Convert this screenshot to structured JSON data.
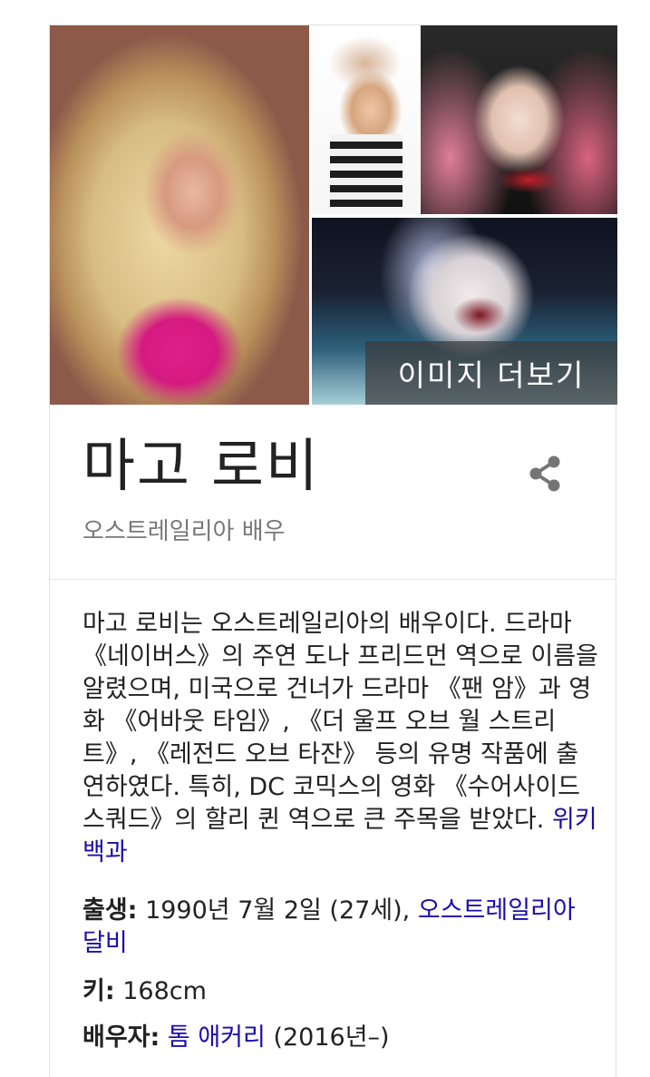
{
  "collage": {
    "more_images_label": "이미지 더보기"
  },
  "entity": {
    "title": "마고 로비",
    "subtitle": "오스트레일리아 배우",
    "share_icon": "share-icon"
  },
  "description": {
    "text": "마고 로비는 오스트레일리아의 배우이다. 드라마 《네이버스》의 주연 도나 프리드먼 역으로 이름을 알렸으며, 미국으로 건너가 드라마 《팬 암》과 영화 《어바웃 타임》, 《더 울프 오브 월 스트리트》, 《레전드 오브 타잔》 등의 유명 작품에 출연하였다. 특히, DC 코믹스의 영화 《수어사이드 스쿼드》의 할리 퀸 역으로 큰 주목을 받았다.",
    "source_link": "위키백과"
  },
  "facts": {
    "born": {
      "label": "출생:",
      "value": "1990년 7월 2일 (27세),",
      "place_link": "오스트레일리아 달비"
    },
    "height": {
      "label": "키:",
      "value": "168cm"
    },
    "spouse": {
      "label": "배우자:",
      "link": "톰 애커리",
      "value": "(2016년–)"
    }
  },
  "colors": {
    "link": "#1a0dab",
    "subtitle": "#777777",
    "text": "#222222"
  }
}
